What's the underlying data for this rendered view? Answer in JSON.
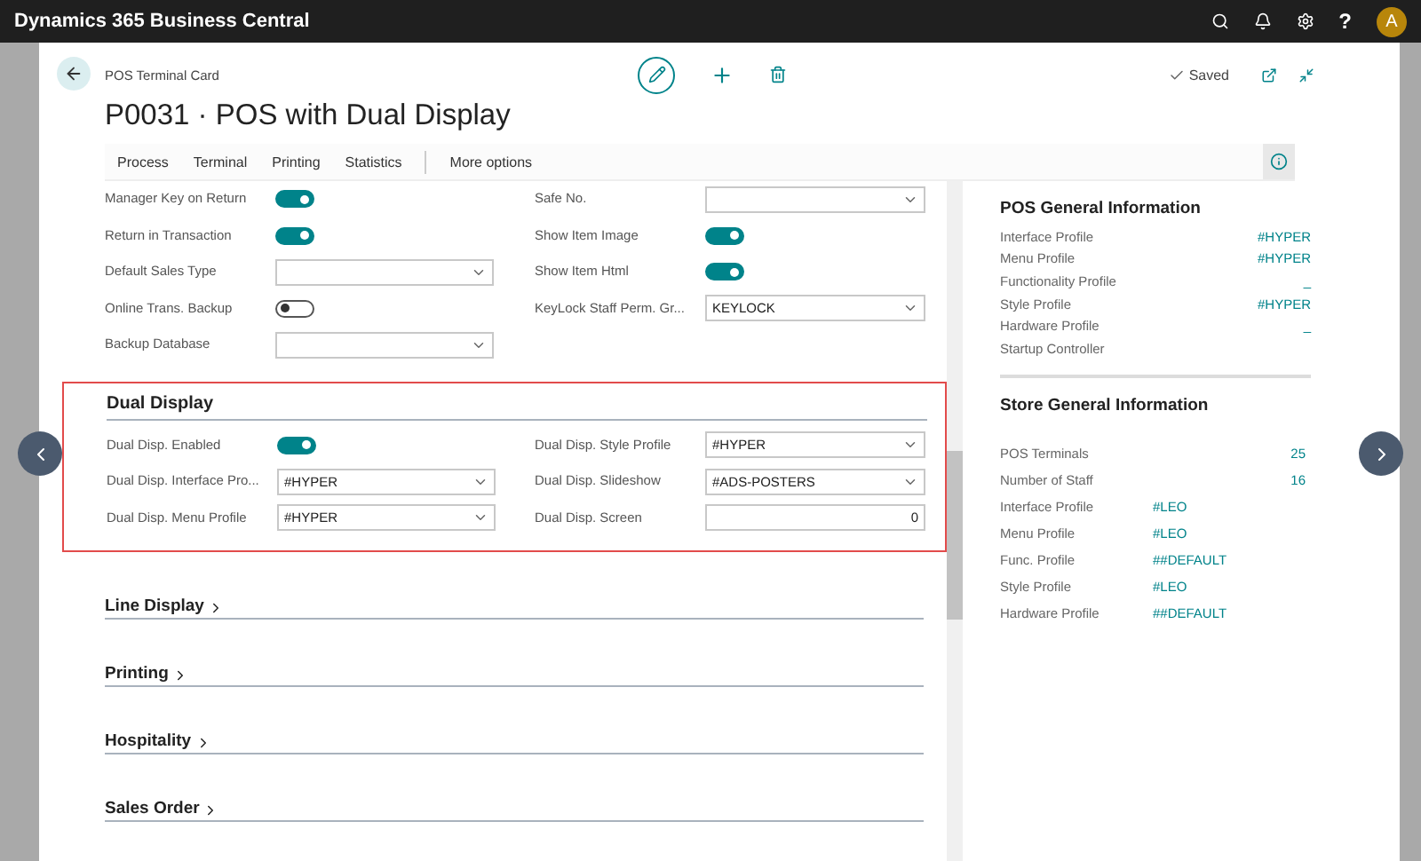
{
  "app_bar": {
    "title": "Dynamics 365 Business Central",
    "help": "?",
    "avatar": "A"
  },
  "card": {
    "caption": "POS Terminal Card",
    "title": "P0031 · POS with Dual Display",
    "saved": "Saved"
  },
  "action_bar": {
    "items": [
      "Process",
      "Terminal",
      "Printing",
      "Statistics"
    ],
    "more": "More options"
  },
  "general": {
    "left": [
      {
        "label": "Manager Key on Return",
        "kind": "toggle",
        "on": true
      },
      {
        "label": "Return in Transaction",
        "kind": "toggle",
        "on": true
      },
      {
        "label": "Default Sales Type",
        "kind": "select"
      },
      {
        "label": "Online Trans. Backup",
        "kind": "toggle",
        "on": false
      },
      {
        "label": "Backup Database",
        "kind": "select"
      }
    ],
    "right": [
      {
        "label": "Safe No.",
        "kind": "select"
      },
      {
        "label": "Show Item Image",
        "kind": "toggle",
        "on": true
      },
      {
        "label": "Show Item Html",
        "kind": "toggle",
        "on": true
      },
      {
        "label": "KeyLock Staff Perm. Gr...",
        "kind": "select",
        "value": "KEYLOCK"
      }
    ]
  },
  "dual_display": {
    "title": "Dual Display",
    "highlighted": true,
    "left": [
      {
        "label": "Dual Disp. Enabled",
        "kind": "toggle",
        "on": true
      },
      {
        "label": "Dual Disp. Interface Pro...",
        "kind": "select",
        "value": "#HYPER"
      },
      {
        "label": "Dual Disp. Menu Profile",
        "kind": "select",
        "value": "#HYPER"
      }
    ],
    "right": [
      {
        "label": "Dual Disp. Style Profile",
        "kind": "select",
        "value": "#HYPER"
      },
      {
        "label": "Dual Disp. Slideshow",
        "kind": "select",
        "value": "#ADS-POSTERS"
      },
      {
        "label": "Dual Disp. Screen",
        "kind": "number",
        "value": "0"
      }
    ]
  },
  "collapsed_sections": [
    "Line Display",
    "Printing",
    "Hospitality",
    "Sales Order"
  ],
  "factbox": {
    "pos_general": {
      "title": "POS General Information",
      "rows": [
        {
          "label": "Interface Profile",
          "value": "#HYPER"
        },
        {
          "label": "Menu Profile",
          "value": "#HYPER"
        },
        {
          "label": "Functionality Profile",
          "value": "_"
        },
        {
          "label": "Style Profile",
          "value": "#HYPER"
        },
        {
          "label": "Hardware Profile",
          "value": "_"
        },
        {
          "label": "Startup Controller"
        }
      ]
    },
    "store_general": {
      "title": "Store General Information",
      "counts": [
        {
          "label": "POS Terminals",
          "value": "25"
        },
        {
          "label": "Number of Staff",
          "value": "16"
        }
      ],
      "profiles": [
        {
          "label": "Interface Profile",
          "value": "#LEO"
        },
        {
          "label": "Menu Profile",
          "value": "#LEO"
        },
        {
          "label": "Func. Profile",
          "value": "##DEFAULT"
        },
        {
          "label": "Style Profile",
          "value": "#LEO"
        },
        {
          "label": "Hardware Profile",
          "value": "##DEFAULT"
        }
      ]
    }
  }
}
